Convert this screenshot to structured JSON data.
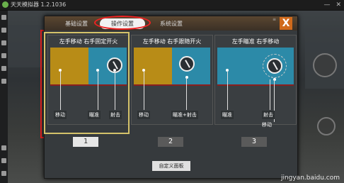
{
  "window": {
    "title": "天天模拟器 1.2.1036",
    "btn_min": "—",
    "btn_close": "✕"
  },
  "tabs": [
    {
      "label": "基础设置"
    },
    {
      "label": "操作设置"
    },
    {
      "label": "系统设置"
    }
  ],
  "close_label": "X",
  "cards": [
    {
      "title": "左手移动 右手固定开火",
      "labels": [
        "移动",
        "瞄准",
        "射击"
      ],
      "number": "1"
    },
    {
      "title": "左手移动 右手跟随开火",
      "labels": [
        "移动",
        "瞄准+射击"
      ],
      "number": "2"
    },
    {
      "title": "左手瞄准 右手移动",
      "labels": [
        "瞄准",
        "射击",
        "移动"
      ],
      "number": "3"
    }
  ],
  "custom_panel_label": "自定义面板",
  "watermark": "jingyan.baidu.com",
  "colors": {
    "gold": "#b88c17",
    "teal": "#2c8aa8",
    "highlight": "#ee2222",
    "close": "#d06a1c"
  }
}
